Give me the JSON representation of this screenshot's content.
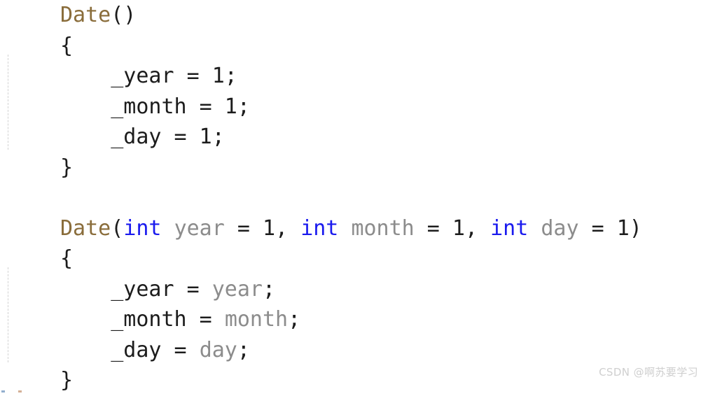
{
  "document": {
    "kind": "code-snippet",
    "language": "cpp",
    "background_color": "#ffffff"
  },
  "colors": {
    "background": "#ffffff",
    "type_name": "#8a6d3b",
    "keyword": "#1a1aee",
    "parameter": "#8c8c8c",
    "plain_text": "#1c1c1c",
    "indent_guide": "#d2d2d2",
    "watermark": "#cfcfcf"
  },
  "code": {
    "lines": [
      {
        "id": "line-1",
        "name": "default-constructor-signature",
        "tokens": [
          {
            "text": "Date",
            "style": "type"
          },
          {
            "text": "()",
            "style": "plain"
          }
        ]
      },
      {
        "id": "line-2",
        "name": "default-constructor-open-brace",
        "tokens": [
          {
            "text": "{",
            "style": "plain"
          }
        ]
      },
      {
        "id": "line-3",
        "name": "assign-year-default",
        "tokens": [
          {
            "text": "    _year = 1;",
            "style": "plain"
          }
        ]
      },
      {
        "id": "line-4",
        "name": "assign-month-default",
        "tokens": [
          {
            "text": "    _month = 1;",
            "style": "plain"
          }
        ]
      },
      {
        "id": "line-5",
        "name": "assign-day-default",
        "tokens": [
          {
            "text": "    _day = 1;",
            "style": "plain"
          }
        ]
      },
      {
        "id": "line-6",
        "name": "default-constructor-close-brace",
        "tokens": [
          {
            "text": "}",
            "style": "plain"
          }
        ]
      },
      {
        "id": "line-7",
        "name": "blank-line",
        "tokens": []
      },
      {
        "id": "line-8",
        "name": "parameterized-constructor-signature",
        "tokens": [
          {
            "text": "Date",
            "style": "type"
          },
          {
            "text": "(",
            "style": "plain"
          },
          {
            "text": "int",
            "style": "keyword"
          },
          {
            "text": " ",
            "style": "plain"
          },
          {
            "text": "year",
            "style": "param"
          },
          {
            "text": " = 1, ",
            "style": "plain"
          },
          {
            "text": "int",
            "style": "keyword"
          },
          {
            "text": " ",
            "style": "plain"
          },
          {
            "text": "month",
            "style": "param"
          },
          {
            "text": " = 1, ",
            "style": "plain"
          },
          {
            "text": "int",
            "style": "keyword"
          },
          {
            "text": " ",
            "style": "plain"
          },
          {
            "text": "day",
            "style": "param"
          },
          {
            "text": " = 1)",
            "style": "plain"
          }
        ]
      },
      {
        "id": "line-9",
        "name": "parameterized-constructor-open-brace",
        "tokens": [
          {
            "text": "{",
            "style": "plain"
          }
        ]
      },
      {
        "id": "line-10",
        "name": "assign-year-param",
        "tokens": [
          {
            "text": "    _year = ",
            "style": "plain"
          },
          {
            "text": "year",
            "style": "param"
          },
          {
            "text": ";",
            "style": "plain"
          }
        ]
      },
      {
        "id": "line-11",
        "name": "assign-month-param",
        "tokens": [
          {
            "text": "    _month = ",
            "style": "plain"
          },
          {
            "text": "month",
            "style": "param"
          },
          {
            "text": ";",
            "style": "plain"
          }
        ]
      },
      {
        "id": "line-12",
        "name": "assign-day-param",
        "tokens": [
          {
            "text": "    _day = ",
            "style": "plain"
          },
          {
            "text": "day",
            "style": "param"
          },
          {
            "text": ";",
            "style": "plain"
          }
        ]
      },
      {
        "id": "line-13",
        "name": "parameterized-constructor-close-brace",
        "tokens": [
          {
            "text": "}",
            "style": "plain"
          }
        ]
      }
    ]
  },
  "watermark": {
    "text": "CSDN @啊苏要学习"
  }
}
